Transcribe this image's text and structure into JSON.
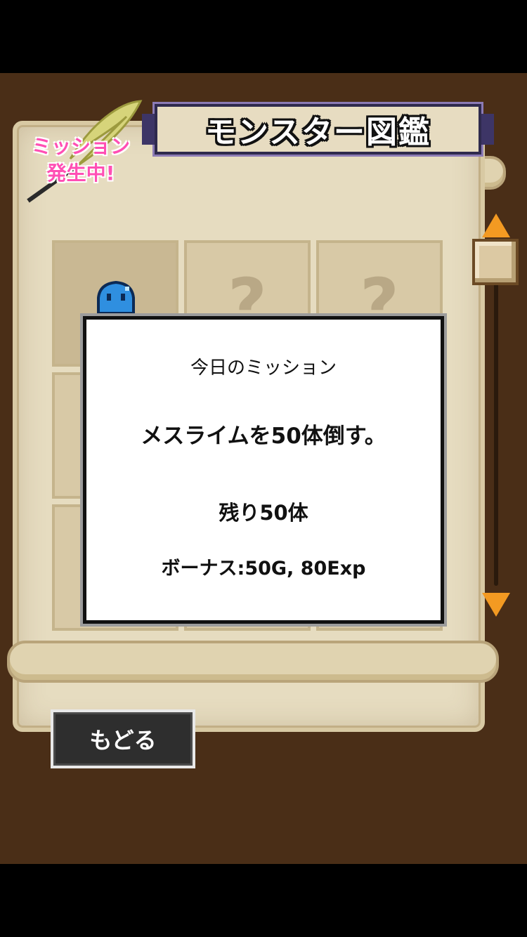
{
  "header": {
    "title": "モンスター図鑑",
    "mission_badge": [
      "ミッション",
      "発生中!"
    ]
  },
  "grid": {
    "cells": [
      {
        "state": "found",
        "icon": "slime-monster-icon",
        "label": ""
      },
      {
        "state": "unknown",
        "label": "?"
      },
      {
        "state": "unknown",
        "label": "?"
      },
      {
        "state": "unknown",
        "label": ""
      },
      {
        "state": "unknown",
        "label": ""
      },
      {
        "state": "unknown",
        "label": ""
      },
      {
        "state": "unknown",
        "label": ""
      },
      {
        "state": "unknown",
        "label": ""
      },
      {
        "state": "unknown",
        "label": ""
      }
    ]
  },
  "popup": {
    "title": "今日のミッション",
    "mission": "メスライムを50体倒す。",
    "remaining": "残り50体",
    "bonus": "ボーナス:50G, 80Exp"
  },
  "scrollbar": {
    "position": 0.0
  },
  "footer": {
    "back_label": "もどる"
  },
  "colors": {
    "background": "#4a2e17",
    "parchment": "#e6dcc0",
    "mission_pink": "#ff4fb4",
    "arrow_orange": "#f39a22",
    "slime_blue": "#2f8fe0"
  }
}
